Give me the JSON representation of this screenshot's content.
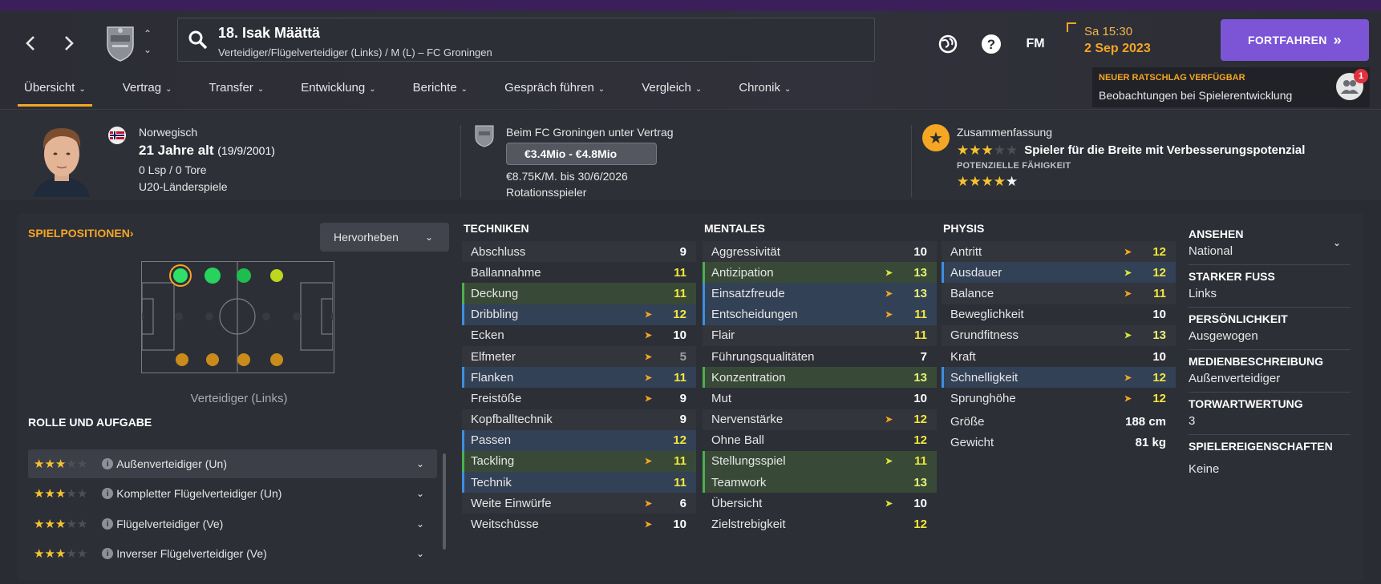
{
  "header": {
    "player_title": "18. Isak Määttä",
    "player_subtitle": "Verteidiger/Flügelverteidiger (Links) / M (L) – FC Groningen",
    "fm_label": "FM",
    "time": "Sa 15:30",
    "date": "2 Sep 2023",
    "continue_label": "FORTFAHREN",
    "advice_title": "NEUER RATSCHLAG VERFÜGBAR",
    "advice_text": "Beobachtungen bei Spielerentwicklung",
    "advice_count": "1"
  },
  "tabs": [
    {
      "label": "Übersicht"
    },
    {
      "label": "Vertrag"
    },
    {
      "label": "Transfer"
    },
    {
      "label": "Entwicklung"
    },
    {
      "label": "Berichte"
    },
    {
      "label": "Gespräch führen"
    },
    {
      "label": "Vergleich"
    },
    {
      "label": "Chronik"
    }
  ],
  "info": {
    "nationality": "Norwegisch",
    "age": "21 Jahre alt",
    "birthdate": "(19/9/2001)",
    "caps": "0 Lsp / 0 Tore",
    "youth_caps": "U20-Länderspiele",
    "contract_title": "Beim FC Groningen unter Vertrag",
    "value_range": "€3.4Mio - €4.8Mio",
    "wage": "€8.75K/M. bis 30/6/2026",
    "squad_status": "Rotationsspieler",
    "summary_title": "Zusammenfassung",
    "summary_text": "Spieler für die Breite mit Verbesserungspotenzial",
    "potential_label": "POTENZIELLE FÄHIGKEIT",
    "current_stars": 3,
    "potential_stars": 4.5
  },
  "positions": {
    "title": "SPIELPOSITIONEN",
    "highlight_label": "Hervorheben",
    "position_label": "Verteidiger (Links)"
  },
  "roles": {
    "title": "ROLLE UND AUFGABE",
    "items": [
      {
        "label": "Außenverteidiger (Un)",
        "stars": 3
      },
      {
        "label": "Kompletter Flügelverteidiger (Un)",
        "stars": 3
      },
      {
        "label": "Flügelverteidiger (Ve)",
        "stars": 3
      },
      {
        "label": "Inverser Flügelverteidiger (Ve)",
        "stars": 3
      }
    ]
  },
  "technical": {
    "title": "TECHNIKEN",
    "rows": [
      {
        "name": "Abschluss",
        "value": "9"
      },
      {
        "name": "Ballannahme",
        "value": "11"
      },
      {
        "name": "Deckung",
        "value": "11"
      },
      {
        "name": "Dribbling",
        "value": "12"
      },
      {
        "name": "Ecken",
        "value": "10"
      },
      {
        "name": "Elfmeter",
        "value": "5"
      },
      {
        "name": "Flanken",
        "value": "11"
      },
      {
        "name": "Freistöße",
        "value": "9"
      },
      {
        "name": "Kopfballtechnik",
        "value": "9"
      },
      {
        "name": "Passen",
        "value": "12"
      },
      {
        "name": "Tackling",
        "value": "11"
      },
      {
        "name": "Technik",
        "value": "11"
      },
      {
        "name": "Weite Einwürfe",
        "value": "6"
      },
      {
        "name": "Weitschüsse",
        "value": "10"
      }
    ]
  },
  "mental": {
    "title": "MENTALES",
    "rows": [
      {
        "name": "Aggressivität",
        "value": "10"
      },
      {
        "name": "Antizipation",
        "value": "13"
      },
      {
        "name": "Einsatzfreude",
        "value": "13"
      },
      {
        "name": "Entscheidungen",
        "value": "11"
      },
      {
        "name": "Flair",
        "value": "11"
      },
      {
        "name": "Führungsqualitäten",
        "value": "7"
      },
      {
        "name": "Konzentration",
        "value": "13"
      },
      {
        "name": "Mut",
        "value": "10"
      },
      {
        "name": "Nervenstärke",
        "value": "12"
      },
      {
        "name": "Ohne Ball",
        "value": "12"
      },
      {
        "name": "Stellungsspiel",
        "value": "11"
      },
      {
        "name": "Teamwork",
        "value": "13"
      },
      {
        "name": "Übersicht",
        "value": "10"
      },
      {
        "name": "Zielstrebigkeit",
        "value": "12"
      }
    ]
  },
  "physical": {
    "title": "PHYSIS",
    "rows": [
      {
        "name": "Antritt",
        "value": "12"
      },
      {
        "name": "Ausdauer",
        "value": "12"
      },
      {
        "name": "Balance",
        "value": "11"
      },
      {
        "name": "Beweglichkeit",
        "value": "10"
      },
      {
        "name": "Grundfitness",
        "value": "13"
      },
      {
        "name": "Kraft",
        "value": "10"
      },
      {
        "name": "Schnelligkeit",
        "value": "12"
      },
      {
        "name": "Sprunghöhe",
        "value": "12"
      },
      {
        "name": "Größe",
        "value": "188 cm"
      },
      {
        "name": "Gewicht",
        "value": "81 kg"
      }
    ]
  },
  "side": {
    "reputation_label": "ANSEHEN",
    "reputation_value": "National",
    "foot_label": "STARKER FUSS",
    "foot_value": "Links",
    "personality_label": "PERSÖNLICHKEIT",
    "personality_value": "Ausgewogen",
    "media_label": "MEDIENBESCHREIBUNG",
    "media_value": "Außenverteidiger",
    "gk_label": "TORWARTWERTUNG",
    "gk_value": "3",
    "traits_label": "SPIELEREIGENSCHAFTEN",
    "traits_value": "Keine"
  },
  "colors": {
    "accent": "#f5a623",
    "continue": "#7b55d6",
    "highlight_green": "#4caf50",
    "highlight_blue": "#3d8fe0"
  }
}
